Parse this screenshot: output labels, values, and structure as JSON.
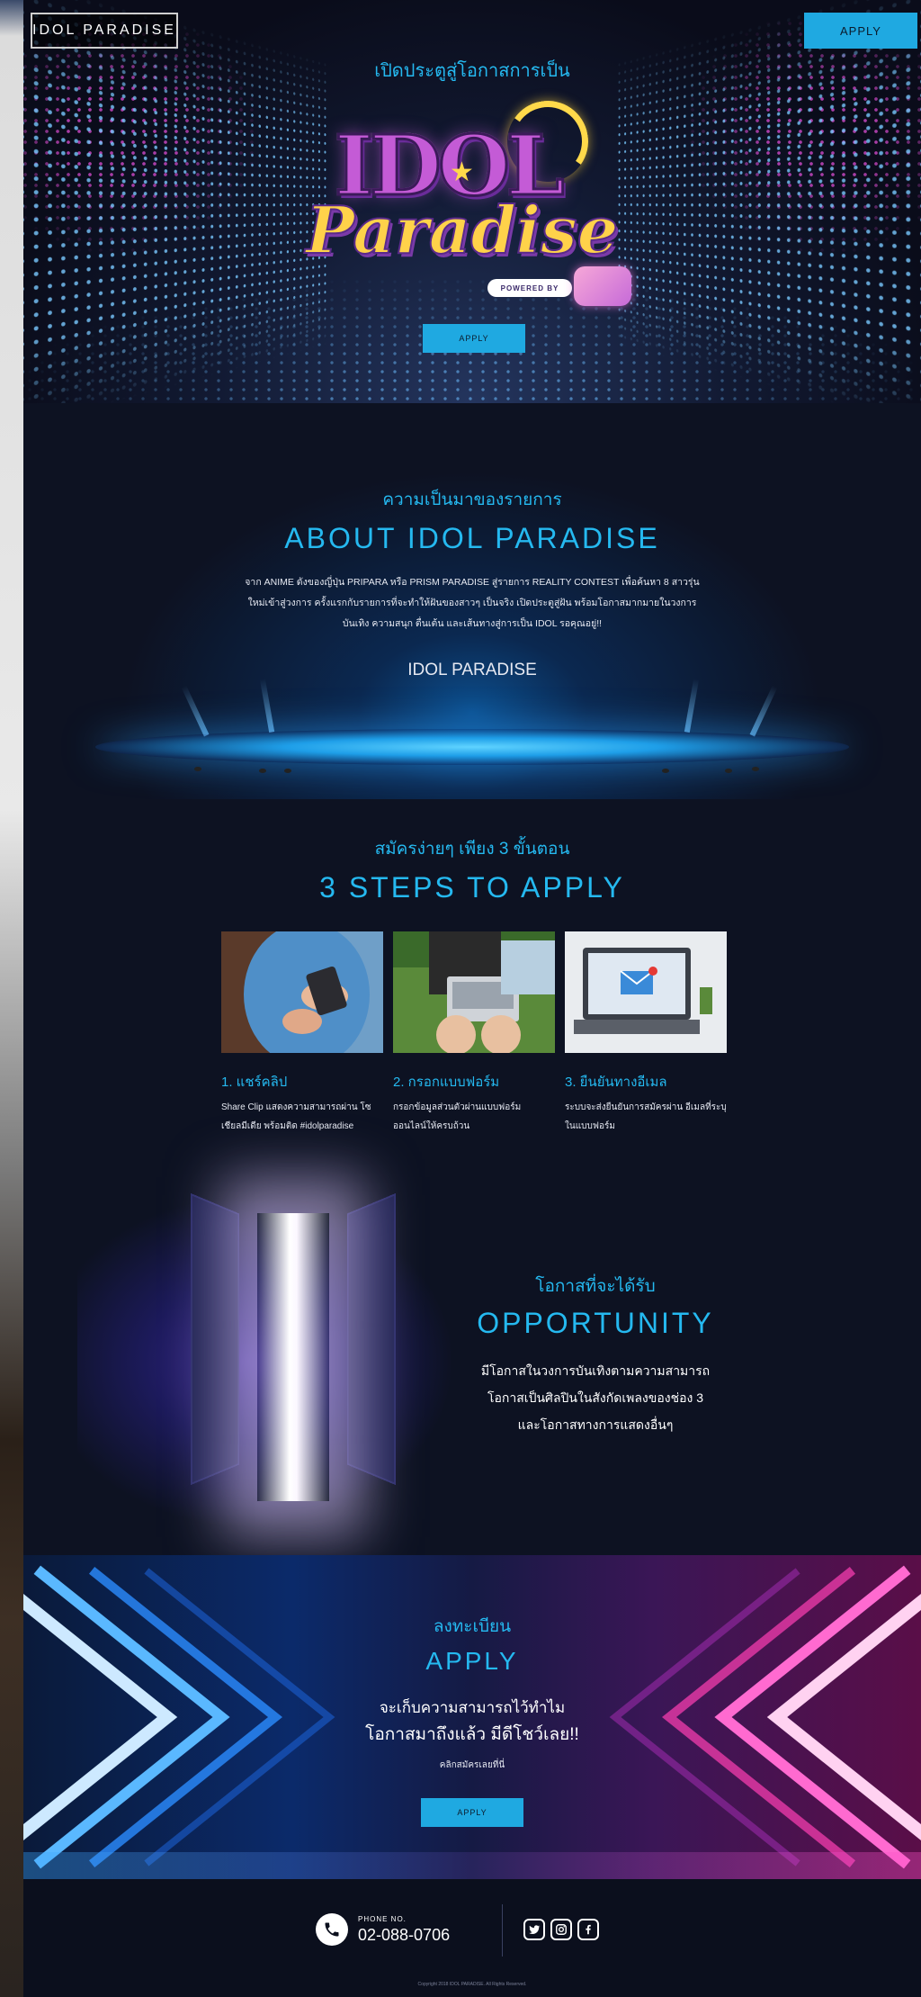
{
  "header": {
    "logo_text": "IDOL PARADISE",
    "apply_label": "APPLY"
  },
  "hero": {
    "eyebrow": "เปิดประตูสู่โอกาสการเป็น",
    "brand_line1": "IDOL",
    "brand_line2": "Paradise",
    "powered_by": "POWERED BY",
    "apply_label": "APPLY"
  },
  "about": {
    "eyebrow": "ความเป็นมาของรายการ",
    "title": "ABOUT IDOL PARADISE",
    "text": "จาก ANIME ดังของญี่ปุ่น PRIPARA หรือ PRISM PARADISE สู่รายการ REALITY CONTEST เพื่อค้นหา 8 สาวรุ่นใหม่เข้าสู่วงการ ครั้งแรกกับรายการที่จะทำให้ฝันของสาวๆ เป็นจริง เปิดประตูสู่ฝัน พร้อมโอกาสมากมายในวงการบันเทิง ความสนุก ตื่นเต้น และเส้นทางสู่การเป็น IDOL รอคุณอยู่!!",
    "signature": "IDOL PARADISE"
  },
  "steps": {
    "eyebrow": "สมัครง่ายๆ เพียง 3 ขั้นตอน",
    "title": "3 STEPS TO APPLY",
    "items": [
      {
        "number": "1. แชร์คลิป",
        "desc": "Share Clip แสดงความสามารถผ่าน โซเชียลมีเดีย พร้อมติด #idolparadise"
      },
      {
        "number": "2. กรอกแบบฟอร์ม",
        "desc": "กรอกข้อมูลส่วนตัวผ่านแบบฟอร์ม ออนไลน์ให้ครบถ้วน"
      },
      {
        "number": "3. ยืนยันทางอีเมล",
        "desc": "ระบบจะส่งยืนยันการสมัครผ่าน อีเมลที่ระบุในแบบฟอร์ม"
      }
    ]
  },
  "opportunity": {
    "eyebrow": "โอกาสที่จะได้รับ",
    "title": "OPPORTUNITY",
    "lines": [
      "มีโอกาสในวงการบันเทิงตามความสามารถ",
      "โอกาสเป็นศิลปินในสังกัดเพลงของช่อง 3",
      "และโอกาสทางการแสดงอื่นๆ"
    ]
  },
  "apply": {
    "eyebrow": "ลงทะเบียน",
    "title": "APPLY",
    "line1": "จะเก็บความสามารถไว้ทำไม",
    "line2": "โอกาสมาถึงแล้ว มีดีโชว์เลย!!",
    "note": "คลิกสมัครเลยที่นี่",
    "button_label": "APPLY"
  },
  "footer": {
    "phone_label": "PHONE NO.",
    "phone_number": "02-088-0706",
    "copyright": "Copyright 2018 IDOL PARADISE. All Rights Reserved."
  },
  "icons": {
    "phone": "phone-icon",
    "twitter": "twitter-icon",
    "instagram": "instagram-icon",
    "facebook": "facebook-icon"
  },
  "colors": {
    "accent": "#1fa9e1",
    "heading": "#25b9f0",
    "background": "#0d1222"
  }
}
